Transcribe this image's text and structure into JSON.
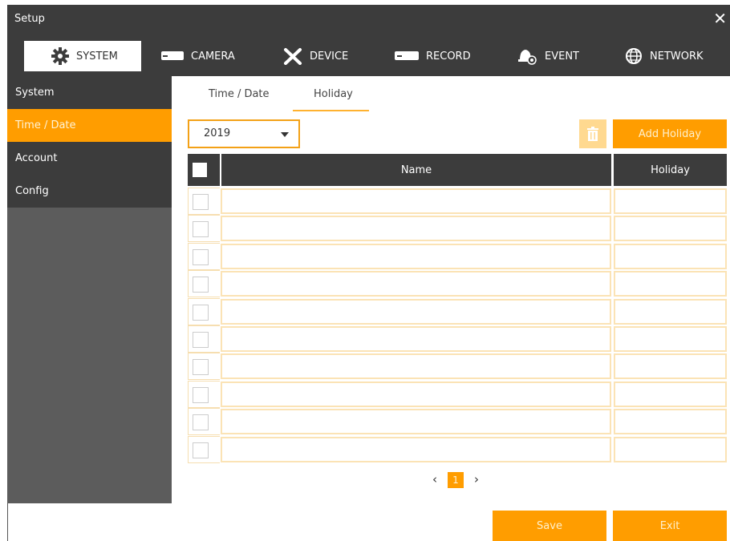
{
  "window": {
    "title": "Setup",
    "close_icon": "close-icon"
  },
  "main_tabs": [
    {
      "label": "SYSTEM",
      "icon": "gear-icon",
      "active": true
    },
    {
      "label": "CAMERA",
      "icon": "camera-icon",
      "active": false
    },
    {
      "label": "DEVICE",
      "icon": "tools-icon",
      "active": false
    },
    {
      "label": "RECORD",
      "icon": "recorder-icon",
      "active": false
    },
    {
      "label": "EVENT",
      "icon": "bell-icon",
      "active": false
    },
    {
      "label": "NETWORK",
      "icon": "globe-icon",
      "active": false
    }
  ],
  "sidebar": {
    "items": [
      {
        "label": "System",
        "active": false
      },
      {
        "label": "Time / Date",
        "active": true
      },
      {
        "label": "Account",
        "active": false
      },
      {
        "label": "Config",
        "active": false
      }
    ]
  },
  "sub_tabs": [
    {
      "label": "Time / Date",
      "active": false
    },
    {
      "label": "Holiday",
      "active": true
    }
  ],
  "toolbar": {
    "year_value": "2019",
    "delete_icon": "trash-icon",
    "add_holiday_label": "Add Holiday"
  },
  "table": {
    "columns": [
      "Name",
      "Holiday"
    ],
    "rows": [
      {
        "name": "",
        "holiday": ""
      },
      {
        "name": "",
        "holiday": ""
      },
      {
        "name": "",
        "holiday": ""
      },
      {
        "name": "",
        "holiday": ""
      },
      {
        "name": "",
        "holiday": ""
      },
      {
        "name": "",
        "holiday": ""
      },
      {
        "name": "",
        "holiday": ""
      },
      {
        "name": "",
        "holiday": ""
      },
      {
        "name": "",
        "holiday": ""
      },
      {
        "name": "",
        "holiday": ""
      }
    ]
  },
  "pagination": {
    "prev": "‹",
    "current_page": "1",
    "next": "›"
  },
  "footer": {
    "save_label": "Save",
    "exit_label": "Exit"
  },
  "colors": {
    "accent": "#ff9d00",
    "dark": "#3c3c3c",
    "sidebar_bg": "#5c5c5c",
    "row_border": "#fbe3b5"
  }
}
